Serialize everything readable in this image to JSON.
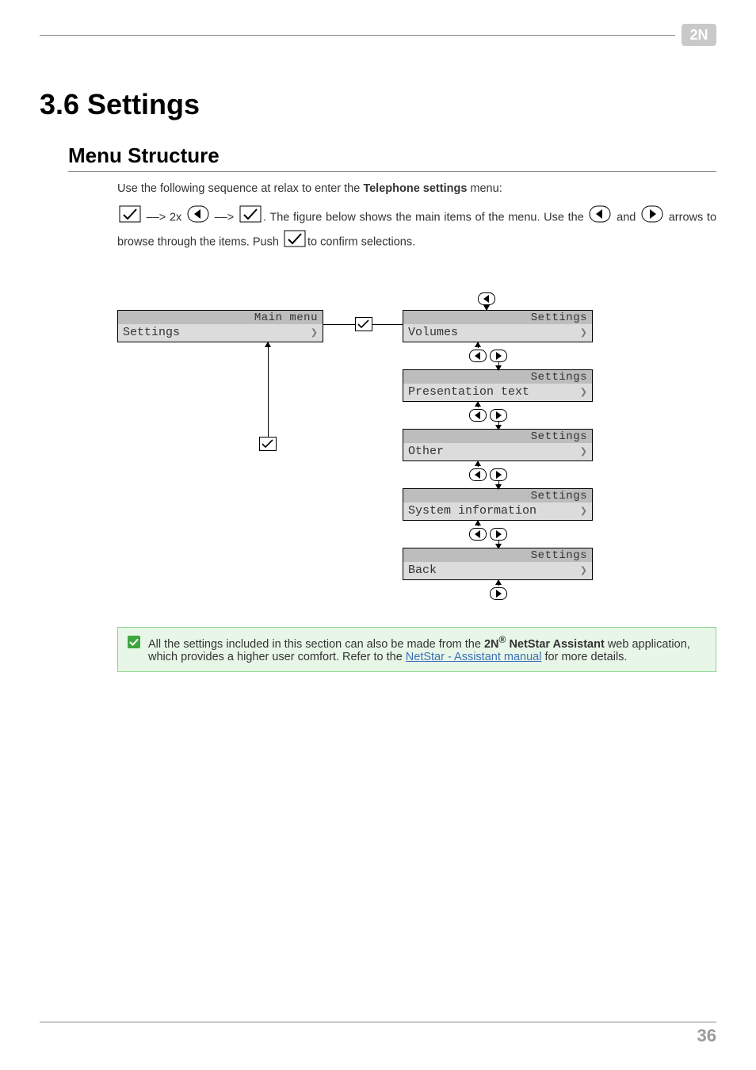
{
  "logo_text": "2N",
  "title": "3.6 Settings",
  "subtitle": "Menu Structure",
  "intro_pre": "Use the following sequence at relax to enter the ",
  "intro_bold": "Telephone settings",
  "intro_post": " menu:",
  "seq_mid": " ––> 2x ",
  "seq_arrow_txt": " ––> ",
  "para2a": ". The figure below shows the main items of the menu. Use the ",
  "para2b": " and ",
  "para2c": " arrows to browse through the items. Push ",
  "para2d": "to confirm selections.",
  "figure": {
    "main_hdr": "Main menu",
    "main_item": "Settings",
    "items": [
      {
        "hdr": "Settings",
        "label": "Volumes"
      },
      {
        "hdr": "Settings",
        "label": "Presentation text"
      },
      {
        "hdr": "Settings",
        "label": "Other"
      },
      {
        "hdr": "Settings",
        "label": "System information"
      },
      {
        "hdr": "Settings",
        "label": "Back"
      }
    ]
  },
  "note": {
    "pre": "All the settings included in this section can also be made from the ",
    "brand_bold": "2N",
    "reg": "®",
    "product_bold": " NetStar Assistant",
    "mid": " web application, which provides a higher user comfort. Refer to the ",
    "link": "NetStar - Assistant manual",
    "post": " for more details."
  },
  "page_number": "36"
}
